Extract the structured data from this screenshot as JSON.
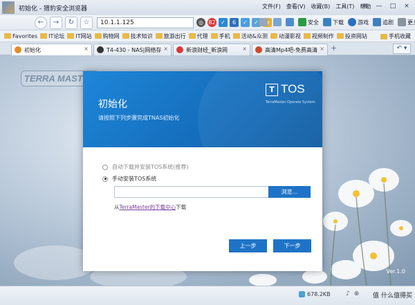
{
  "window": {
    "title": "初始化 - 猎豹安全浏览器",
    "menus": [
      "文件(F)",
      "查看(V)",
      "收藏(B)",
      "工具(T)",
      "帮助"
    ],
    "controls": [
      "≡",
      "—",
      "□",
      "×"
    ]
  },
  "nav": {
    "back": "←",
    "forward": "→",
    "refresh": "↻",
    "home": "☆",
    "url": "10.1.1.125",
    "addr_badges": [
      "◎",
      "82",
      "✓",
      "6",
      "✓",
      "✓",
      "★"
    ],
    "tools": {
      "compat": "",
      "safe_label": "安全",
      "download_label": "下载",
      "game_label": "游戏",
      "tracking_label": "追剧",
      "more_label": "更多"
    }
  },
  "favorites": {
    "items": [
      "Favorites",
      "IT论坛",
      "IT网站",
      "购物网",
      "技术知识",
      "旅游出行",
      "代理",
      "手机",
      "活动&众测",
      "动漫影视",
      "视频制作",
      "投资网站"
    ],
    "right": "手机收藏"
  },
  "tabs": [
    {
      "label": "初始化",
      "color": "#e58a2a"
    },
    {
      "label": "T4-430 - NAS|网络存...",
      "color": "#333333"
    },
    {
      "label": "新浪财经_新浪网",
      "color": "#d83a3a"
    },
    {
      "label": "高清Mp4吧-免费高清...",
      "color": "#d04a2a"
    }
  ],
  "tabbar": {
    "new_tab": "+",
    "back_menu": "↶ ▾"
  },
  "page": {
    "brand": "TERRA MASTER",
    "version": "Ver.1.0",
    "dialog": {
      "title": "初始化",
      "subtitle": "请按照下列步骤完成TNAS初始化",
      "tos_mark": "T",
      "tos_text": "TOS",
      "tos_tagline": "TerraMaster Operate System",
      "option_auto": "自动下载并安装TOS系统(推荐)",
      "option_manual": "手动安装TOS系统",
      "file_path": "",
      "browse": "浏览...",
      "download_prefix": "从",
      "download_link": "TerraMaster的下载中心",
      "download_suffix": "下载",
      "prev": "上一步",
      "next": "下一步"
    }
  },
  "status": {
    "speed": "678.2KB",
    "zoom": "",
    "watermark": "值 什么值得买"
  }
}
